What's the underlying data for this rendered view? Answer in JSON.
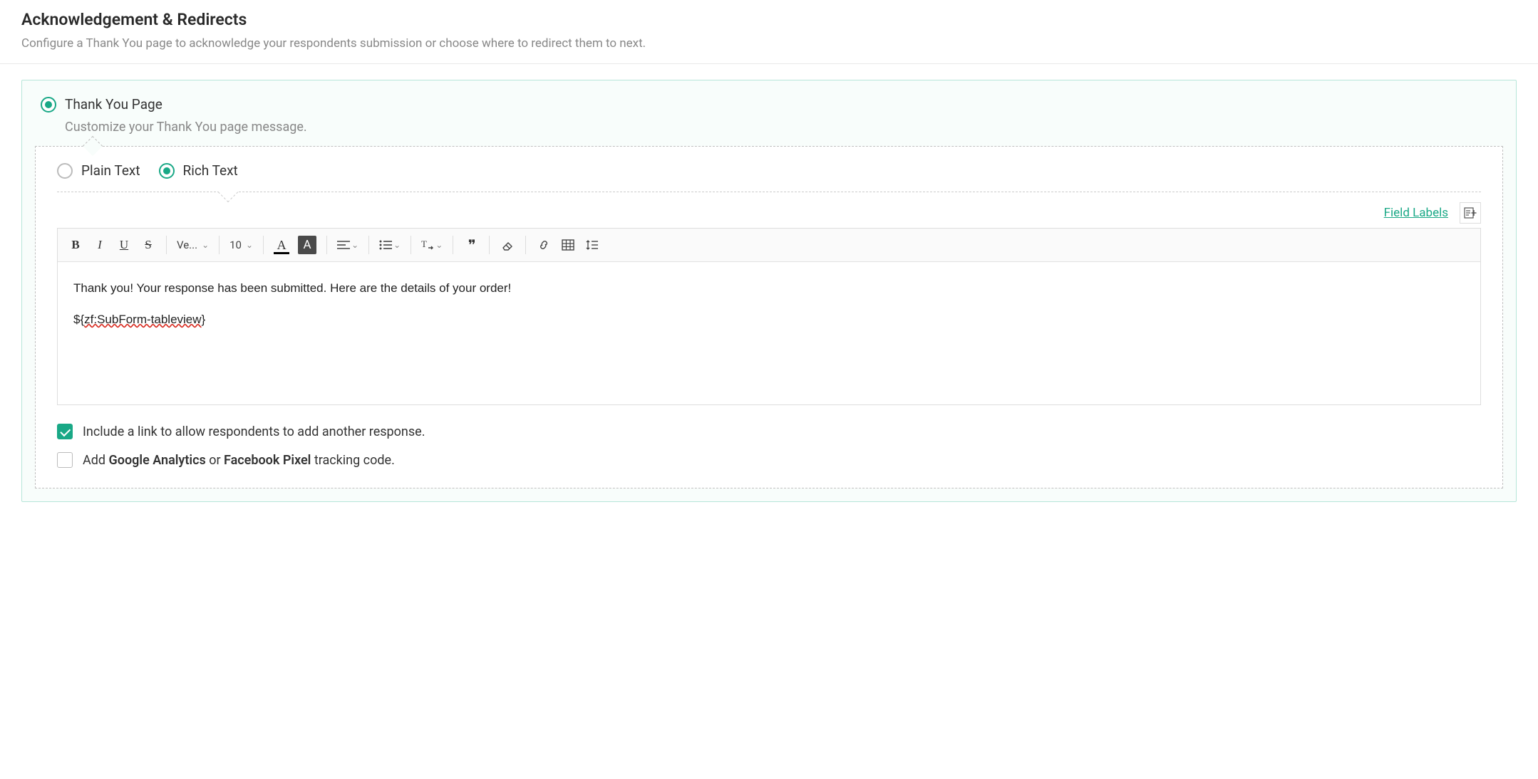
{
  "header": {
    "title": "Acknowledgement & Redirects",
    "subtitle": "Configure a Thank You page to acknowledge your respondents submission or choose where to redirect them to next."
  },
  "option": {
    "thank_you": {
      "label": "Thank You Page",
      "desc": "Customize your Thank You page message."
    }
  },
  "format": {
    "plain": "Plain Text",
    "rich": "Rich Text"
  },
  "links": {
    "field_labels": "Field Labels"
  },
  "toolbar": {
    "font_family": "Ve...",
    "font_size": "10"
  },
  "editor": {
    "line1": "Thank you! Your response has been submitted. Here are the details of your order!",
    "line2_prefix": "${",
    "line2_err": "zf:SubForm-tableview",
    "line2_suffix": "}"
  },
  "checks": {
    "include_link": "Include a link to allow respondents to add another response.",
    "ga_prefix": "Add ",
    "ga_bold1": "Google Analytics",
    "ga_mid": " or ",
    "ga_bold2": "Facebook Pixel",
    "ga_suffix": " tracking code."
  }
}
